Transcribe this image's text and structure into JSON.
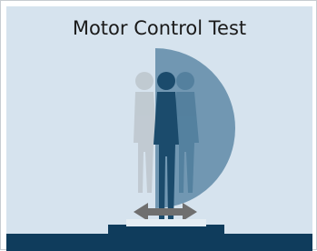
{
  "title": "Motor Control Test",
  "colors": {
    "background": "#d6e3ee",
    "figure_main": "#1b4b6c",
    "figure_ghost_left": "#bdc6cd",
    "figure_ghost_right": "#4f7d9b",
    "arc": "#5f8aa7",
    "platform": "#0f3c5c",
    "arrow": "#6f6f6f"
  },
  "icons": {
    "figure": "standing-person-icon",
    "arc": "sway-arc-icon",
    "platform": "force-platform-icon",
    "arrow": "horizontal-double-arrow-icon"
  }
}
